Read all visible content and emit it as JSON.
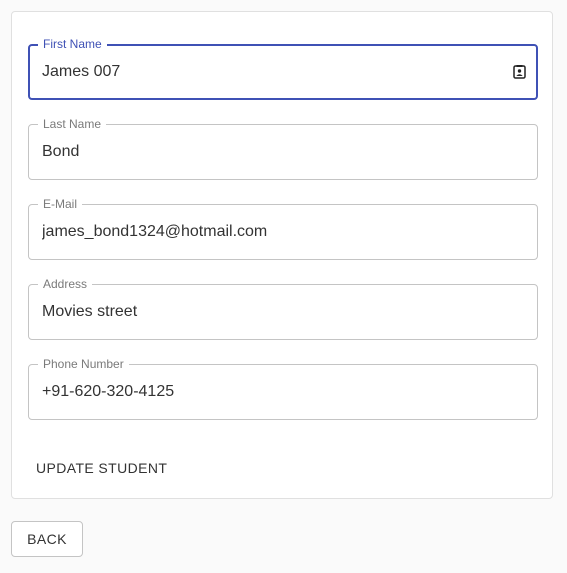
{
  "form": {
    "fields": [
      {
        "label": "First Name",
        "value": "James 007"
      },
      {
        "label": "Last Name",
        "value": "Bond"
      },
      {
        "label": "E-Mail",
        "value": "james_bond1324@hotmail.com"
      },
      {
        "label": "Address",
        "value": "Movies street"
      },
      {
        "label": "Phone Number",
        "value": "+91-620-320-4125"
      }
    ],
    "update_label": "UPDATE STUDENT"
  },
  "back_label": "BACK",
  "colors": {
    "accent": "#3f51b5",
    "border": "#c4c4c4",
    "label": "#7a7a7a"
  },
  "icons": {
    "first_name_adornment": "contact-card-icon"
  }
}
